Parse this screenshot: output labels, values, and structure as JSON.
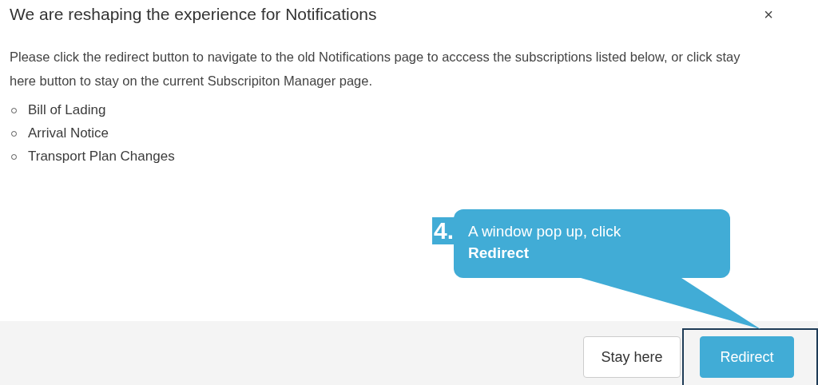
{
  "dialog": {
    "title": "We are reshaping the experience for Notifications",
    "close": "×",
    "message": "Please click the redirect button to navigate to the old Notifications page to acccess the subscriptions listed below, or click stay here button to stay on the current Subscripiton Manager page.",
    "items": [
      "Bill of Lading",
      "Arrival Notice",
      "Transport Plan Changes"
    ],
    "buttons": [
      {
        "label": "Stay here",
        "kind": "secondary",
        "highlighted": false
      },
      {
        "label": "Redirect",
        "kind": "primary",
        "highlighted": true
      }
    ]
  },
  "callout": {
    "step": "4.",
    "text": "A window pop up, click **Redirect**"
  }
}
